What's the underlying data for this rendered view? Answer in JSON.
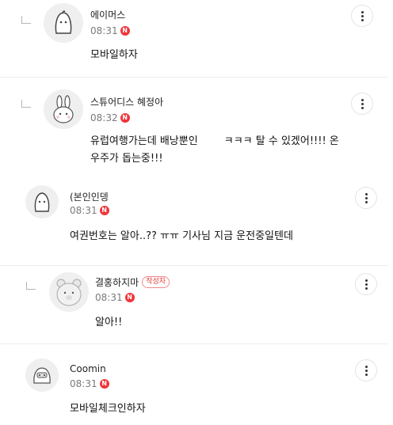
{
  "comments": [
    {
      "nickname": "에이머스",
      "time": "08:31",
      "new_badge": "N",
      "text": "모바일하자",
      "is_reply": true
    },
    {
      "nickname": "스튜어디스 혜정아",
      "time": "08:32",
      "new_badge": "N",
      "text": "유럽여행가는데 배낭뿐인        ㅋㅋㅋ 탈 수 있겠어!!!! 온\n우주가 돕는중!!!",
      "is_reply": true
    },
    {
      "nickname": "(본인인뎅",
      "time": "08:31",
      "new_badge": "N",
      "text": "여권번호는 알아..?? ㅠㅠ 기사님 지금 운전중일텐데",
      "is_reply": false
    },
    {
      "nickname": "결홍하지마",
      "author_badge": "작성자",
      "time": "08:31",
      "new_badge": "N",
      "text": "알아!!",
      "is_reply": true
    },
    {
      "nickname": "Coomin",
      "time": "08:31",
      "new_badge": "N",
      "text": "모바일체크인하자",
      "is_reply": false
    }
  ],
  "icons": {
    "reply": "reply-arrow-icon",
    "more": "more-vertical-icon",
    "new": "new-badge-icon"
  },
  "colors": {
    "new_badge": "#f0353b",
    "author_badge": "#e53935",
    "divider": "#ececec",
    "meta_text": "#7a7a7a"
  }
}
